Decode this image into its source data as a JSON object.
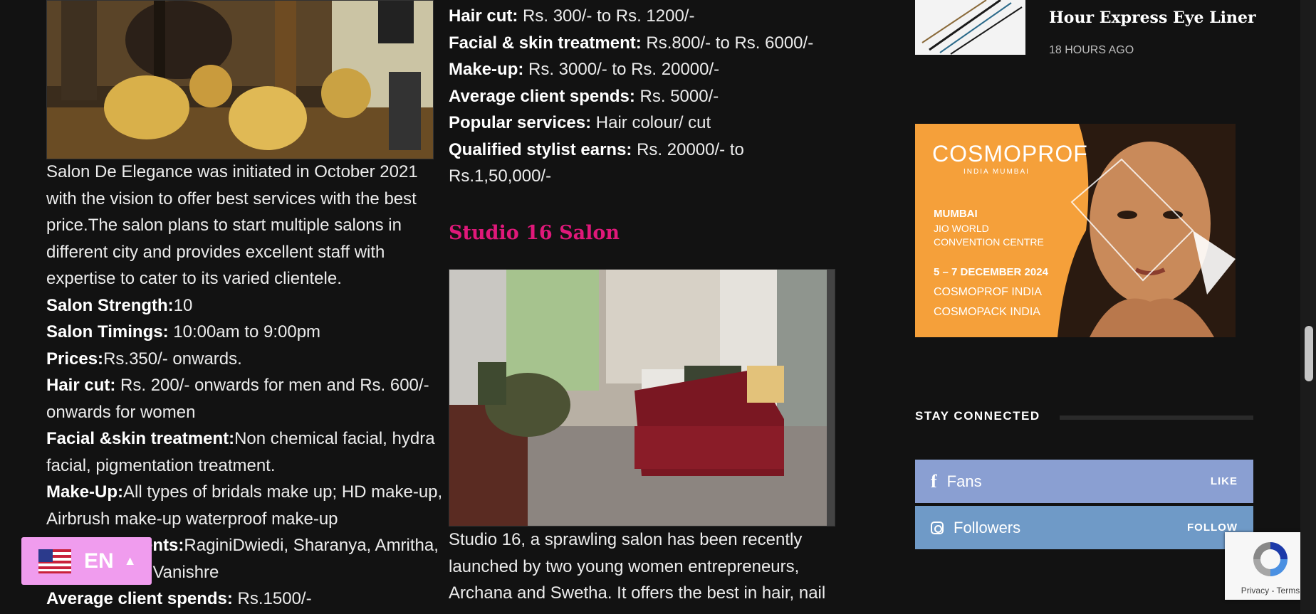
{
  "left_column": {
    "intro": "Salon De Elegance was initiated in October 2021 with the vision to offer best services with the best price.The salon plans to start multiple salons in different city and provides excellent staff with expertise to cater to its varied clientele.",
    "items": [
      {
        "label": "Salon Strength:",
        "value": "10"
      },
      {
        "label": "Salon Timings:",
        "value": " 10:00am to 9:00pm"
      },
      {
        "label": "Prices:",
        "value": "Rs.350/- onwards."
      },
      {
        "label": "Hair cut:",
        "value": " Rs. 200/- onwards for men and Rs. 600/- onwards for women"
      },
      {
        "label": "Facial &skin treatment:",
        "value": "Non chemical facial, hydra facial, pigmentation treatment."
      },
      {
        "label": "Make-Up:",
        "value": "All types of bridals make up; HD make-up, Airbrush make-up waterproof make-up"
      },
      {
        "label": "Celebrity clients:",
        "value": "RaginiDwiedi, Sharanya, Amritha, Sana Shalani,Vanishre"
      },
      {
        "label": "Average client spends:",
        "value": " Rs.1500/-"
      }
    ]
  },
  "middle_column": {
    "items": [
      {
        "label": "Hair cut:",
        "value": " Rs. 300/- to Rs. 1200/-"
      },
      {
        "label": "Facial & skin treatment:",
        "value": " Rs.800/- to Rs. 6000/-"
      },
      {
        "label": "Make-up:",
        "value": " Rs. 3000/- to Rs. 20000/-"
      },
      {
        "label": "Average client spends:",
        "value": " Rs. 5000/-"
      },
      {
        "label": "Popular services:",
        "value": " Hair colour/ cut"
      },
      {
        "label": "Qualified stylist earns:",
        "value": " Rs. 20000/- to Rs.1,50,000/-"
      }
    ],
    "heading": "Studio 16 Salon",
    "body": "Studio 16, a sprawling salon has been recently launched by two young women entrepreneurs, Archana and Swetha. It offers the best in hair, nail"
  },
  "sidebar": {
    "post": {
      "title": "Hour Express Eye Liner",
      "time": "18 HOURS AGO"
    },
    "ad": {
      "brand": "COSMOPROF",
      "brand_sub": "INDIA MUMBAI",
      "city": "MUMBAI",
      "venue": "JIO WORLD CONVENTION CENTRE",
      "dates": "5 – 7 DECEMBER 2024",
      "line1": "COSMOPROF INDIA",
      "line2": "COSMOPACK INDIA"
    },
    "stay_connected": "STAY CONNECTED",
    "social": [
      {
        "label": "Fans",
        "action": "LIKE",
        "color": "#8a9fd2"
      },
      {
        "label": "Followers",
        "action": "FOLLOW",
        "color": "#6f9ac7"
      }
    ]
  },
  "language": {
    "code": "EN"
  },
  "recaptcha": {
    "links": "Privacy - Terms"
  }
}
